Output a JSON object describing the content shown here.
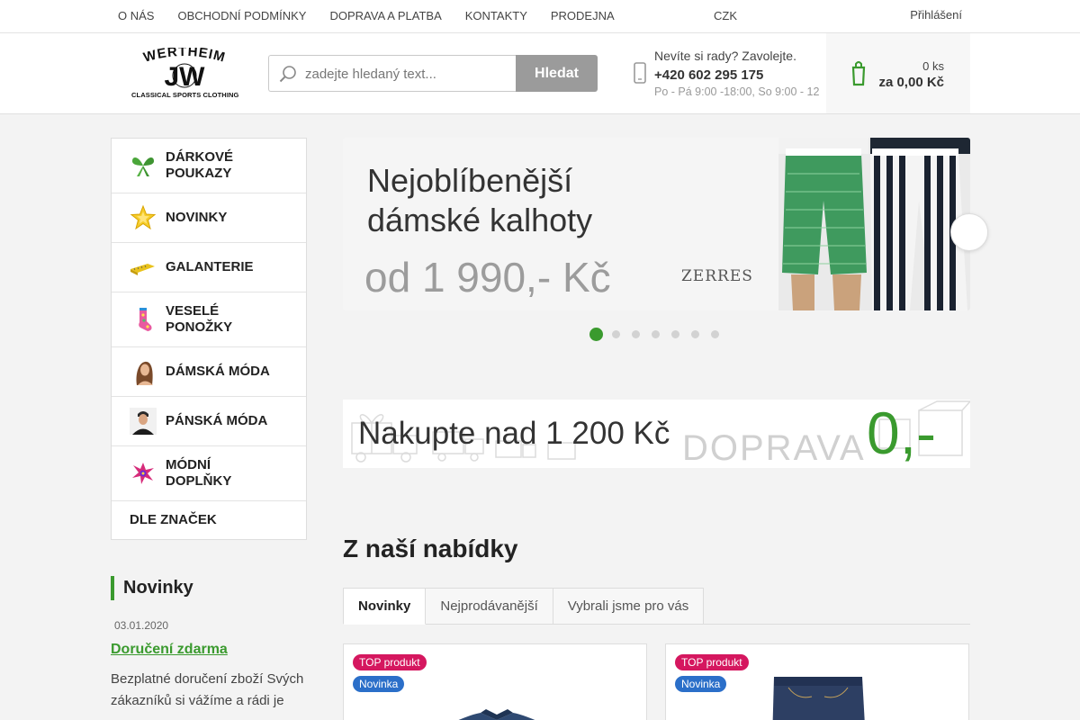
{
  "topbar": {
    "links": [
      "O NÁS",
      "OBCHODNÍ PODMÍNKY",
      "DOPRAVA A PLATBA",
      "KONTAKTY",
      "PRODEJNA"
    ],
    "currency": "CZK",
    "currency_icon": "",
    "caret_icon": "",
    "login": "Přihlášení",
    "login_icon": ""
  },
  "header": {
    "logo_wordmark": "WERTHEIM",
    "logo_initials": "JW",
    "logo_tagline": "CLASSICAL SPORTS CLOTHING",
    "search_placeholder": "zadejte hledaný text...",
    "search_button": "Hledat",
    "contact_line1": "Nevíte si rady? Zavolejte.",
    "contact_phone": "+420 602 295 175",
    "contact_hours": "Po - Pá 9:00 -18:00, So 9:00 - 12",
    "cart_count": "0 ks",
    "cart_total": "za 0,00 Kč"
  },
  "categories": [
    {
      "label_lines": [
        "DÁRKOVÉ",
        "POUKAZY"
      ],
      "icon": "gift-bow-icon",
      "arrow": false
    },
    {
      "label_lines": [
        "NOVINKY"
      ],
      "icon": "star-icon",
      "arrow": false
    },
    {
      "label_lines": [
        "GALANTERIE"
      ],
      "icon": "measuring-tape-icon",
      "arrow": true
    },
    {
      "label_lines": [
        "VESELÉ",
        "PONOŽKY"
      ],
      "icon": "sock-icon",
      "arrow": false
    },
    {
      "label_lines": [
        "DÁMSKÁ MÓDA"
      ],
      "icon": "woman-icon",
      "arrow": true
    },
    {
      "label_lines": [
        "PÁNSKÁ MÓDA"
      ],
      "icon": "man-icon",
      "arrow": true
    },
    {
      "label_lines": [
        "MÓDNÍ",
        "DOPLŇKY"
      ],
      "icon": "accessories-icon",
      "arrow": true
    },
    {
      "label_lines": [
        "DLE ZNAČEK"
      ],
      "icon": "",
      "arrow": true
    }
  ],
  "category_arrow": "",
  "news": {
    "heading": "Novinky",
    "date_icon": "",
    "date": "03.01.2020",
    "title": "Doručení zdarma",
    "text": "Bezplatné doručení zboží Svých zákazníků si vážíme a rádi je"
  },
  "slider": {
    "line1": "Nejoblíbenější",
    "line2": "dámské kalhoty",
    "price": "od 1 990,- Kč",
    "brand": "ZERRES",
    "next_icon": "",
    "slide_count": 7,
    "active_slide": 1
  },
  "shipping_banner": {
    "text": "Nakupte nad 1 200 Kč",
    "word": "DOPRAVA",
    "price": "0,-"
  },
  "offer": {
    "title": "Z naší nabídky",
    "tabs": [
      "Novinky",
      "Nejprodávanější",
      "Vybrali jsme pro vás"
    ],
    "active_tab": 0
  },
  "products": [
    {
      "badges": [
        "TOP produkt",
        "Novinka"
      ],
      "image": "denim-jacket"
    },
    {
      "badges": [
        "TOP produkt",
        "Novinka"
      ],
      "image": "denim-shorts"
    }
  ],
  "colors": {
    "accent": "#3a9a2e",
    "badge_top": "#d5175f",
    "badge_new": "#2b6fc9",
    "search_button": "#9b9b9b"
  }
}
